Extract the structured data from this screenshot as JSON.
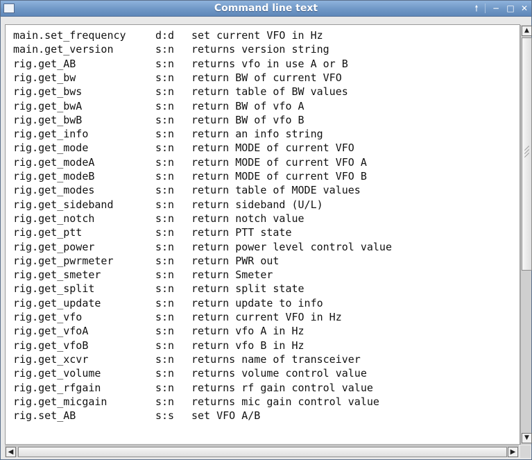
{
  "window": {
    "title": "Command line text",
    "controls": {
      "pin": "🠕",
      "minimize": "−",
      "maximize": "□",
      "close": "✕"
    }
  },
  "lines": [
    [
      "main.set_frequency",
      "d:d",
      "set current VFO in Hz"
    ],
    [
      "main.get_version",
      "s:n",
      "returns version string"
    ],
    [
      "rig.get_AB",
      "s:n",
      "returns vfo in use A or B"
    ],
    [
      "rig.get_bw",
      "s:n",
      "return BW of current VFO"
    ],
    [
      "rig.get_bws",
      "s:n",
      "return table of BW values"
    ],
    [
      "rig.get_bwA",
      "s:n",
      "return BW of vfo A"
    ],
    [
      "rig.get_bwB",
      "s:n",
      "return BW of vfo B"
    ],
    [
      "rig.get_info",
      "s:n",
      "return an info string"
    ],
    [
      "rig.get_mode",
      "s:n",
      "return MODE of current VFO"
    ],
    [
      "rig.get_modeA",
      "s:n",
      "return MODE of current VFO A"
    ],
    [
      "rig.get_modeB",
      "s:n",
      "return MODE of current VFO B"
    ],
    [
      "rig.get_modes",
      "s:n",
      "return table of MODE values"
    ],
    [
      "rig.get_sideband",
      "s:n",
      "return sideband (U/L)"
    ],
    [
      "rig.get_notch",
      "s:n",
      "return notch value"
    ],
    [
      "rig.get_ptt",
      "s:n",
      "return PTT state"
    ],
    [
      "rig.get_power",
      "s:n",
      "return power level control value"
    ],
    [
      "rig.get_pwrmeter",
      "s:n",
      "return PWR out"
    ],
    [
      "rig.get_smeter",
      "s:n",
      "return Smeter"
    ],
    [
      "rig.get_split",
      "s:n",
      "return split state"
    ],
    [
      "rig.get_update",
      "s:n",
      "return update to info"
    ],
    [
      "rig.get_vfo",
      "s:n",
      "return current VFO in Hz"
    ],
    [
      "rig.get_vfoA",
      "s:n",
      "return vfo A in Hz"
    ],
    [
      "rig.get_vfoB",
      "s:n",
      "return vfo B in Hz"
    ],
    [
      "rig.get_xcvr",
      "s:n",
      "returns name of transceiver"
    ],
    [
      "rig.get_volume",
      "s:n",
      "returns volume control value"
    ],
    [
      "rig.get_rfgain",
      "s:n",
      "returns rf gain control value"
    ],
    [
      "rig.get_micgain",
      "s:n",
      "returns mic gain control value"
    ],
    [
      "rig.set_AB",
      "s:s",
      "set VFO A/B"
    ]
  ],
  "scrollbars": {
    "vertical_position": 0.0,
    "arrows": {
      "up": "▲",
      "down": "▼",
      "left": "◀",
      "right": "▶"
    }
  }
}
